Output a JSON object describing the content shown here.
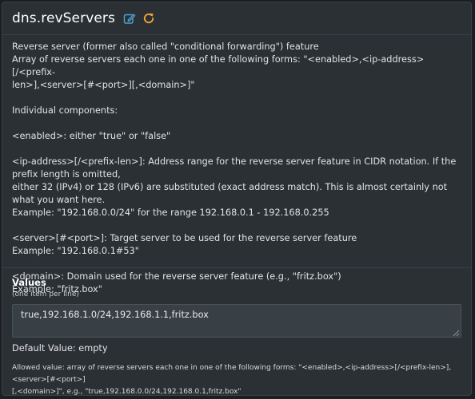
{
  "header": {
    "title": "dns.revServers",
    "edit_icon": "pencil-square-icon",
    "reset_icon": "rotate-icon"
  },
  "colors": {
    "edit_icon": "#4ea3d8",
    "reset_icon": "#f0a23a"
  },
  "description": {
    "line1": "Reverse server (former also called \"conditional forwarding\") feature",
    "line2": "Array of reverse servers each one in one of the following forms: \"<enabled>,<ip-address>[/<prefix-",
    "line3": "len>],<server>[#<port>][,<domain>]\"",
    "components_heading": "Individual components:",
    "enabled": "<enabled>: either \"true\" or \"false\"",
    "ip_line1": "<ip-address>[/<prefix-len>]: Address range for the reverse server feature in CIDR notation. If the prefix length is omitted,",
    "ip_line2": "either 32 (IPv4) or 128 (IPv6) are substituted (exact address match). This is almost certainly not what you want here.",
    "ip_example": "Example: \"192.168.0.0/24\" for the range 192.168.0.1 - 192.168.0.255",
    "server": "<server>[#<port>]: Target server to be used for the reverse server feature",
    "server_example": "Example: \"192.168.0.1#53\"",
    "domain": "<domain>: Domain used for the reverse server feature (e.g., \"fritz.box\")",
    "domain_example": "Example: \"fritz.box\""
  },
  "values": {
    "label": "Values",
    "hint": "(one item per line)",
    "textarea_value": "true,192.168.1.0/24,192.168.1.1,fritz.box",
    "default_value": "Default Value: empty",
    "allowed_line1": "Allowed value: array of reverse servers each one in one of the following forms: \"<enabled>,<ip-address>[/<prefix-len>],<server>[#<port>]",
    "allowed_line2": "[,<domain>]\", e.g., \"true,192.168.0.0/24,192.168.0.1,fritz.box\""
  }
}
